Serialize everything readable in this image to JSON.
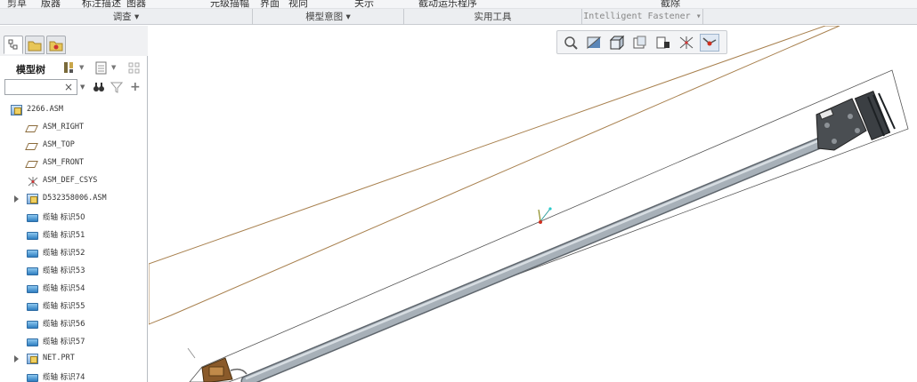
{
  "ribbon": {
    "top_items": [
      "剪草",
      "版器",
      "标注描述",
      "图器",
      "元级描幅",
      "界面",
      "视向",
      "关示",
      "截动运乐程序",
      "截除"
    ],
    "groups": [
      "调查",
      "模型意图",
      "实用工具",
      "Intelligent Fastener"
    ]
  },
  "panel": {
    "tree_title": "模型树",
    "search_value": "",
    "clear_glyph": "×",
    "items": [
      {
        "label": "2266.ASM",
        "icon": "assembly-icon",
        "expandable": false,
        "indent": 0
      },
      {
        "label": "ASM_RIGHT",
        "icon": "datum-plane-icon",
        "expandable": false,
        "indent": 1
      },
      {
        "label": "ASM_TOP",
        "icon": "datum-plane-icon",
        "expandable": false,
        "indent": 1
      },
      {
        "label": "ASM_FRONT",
        "icon": "datum-plane-icon",
        "expandable": false,
        "indent": 1
      },
      {
        "label": "ASM_DEF_CSYS",
        "icon": "csys-icon",
        "expandable": false,
        "indent": 1
      },
      {
        "label": "D532358006.ASM",
        "icon": "assembly-icon",
        "expandable": true,
        "indent": 1
      },
      {
        "label": "缆轴 标识50",
        "icon": "cable-axis-icon",
        "expandable": false,
        "indent": 1
      },
      {
        "label": "缆轴 标识51",
        "icon": "cable-axis-icon",
        "expandable": false,
        "indent": 1
      },
      {
        "label": "缆轴 标识52",
        "icon": "cable-axis-icon",
        "expandable": false,
        "indent": 1
      },
      {
        "label": "缆轴 标识53",
        "icon": "cable-axis-icon",
        "expandable": false,
        "indent": 1
      },
      {
        "label": "缆轴 标识54",
        "icon": "cable-axis-icon",
        "expandable": false,
        "indent": 1
      },
      {
        "label": "缆轴 标识55",
        "icon": "cable-axis-icon",
        "expandable": false,
        "indent": 1
      },
      {
        "label": "缆轴 标识56",
        "icon": "cable-axis-icon",
        "expandable": false,
        "indent": 1
      },
      {
        "label": "缆轴 标识57",
        "icon": "cable-axis-icon",
        "expandable": false,
        "indent": 1
      },
      {
        "label": "NET.PRT",
        "icon": "part-icon",
        "expandable": true,
        "indent": 1
      },
      {
        "label": "缆轴 标识74",
        "icon": "cable-axis-icon",
        "expandable": false,
        "indent": 1
      }
    ]
  },
  "view_toolbar": {
    "buttons": [
      "refit-icon",
      "saved-orientations-icon",
      "display-style-icon",
      "view-manager-icon",
      "appearance-icon",
      "datum-display-icon",
      "spin-center-icon"
    ]
  },
  "colors": {
    "ribbon_bg": "#eceef1",
    "panel_border": "#b8bcc2",
    "cable": "#9aa3ac",
    "datum_plane": "#a8804e",
    "bounding_box": "#555555"
  }
}
